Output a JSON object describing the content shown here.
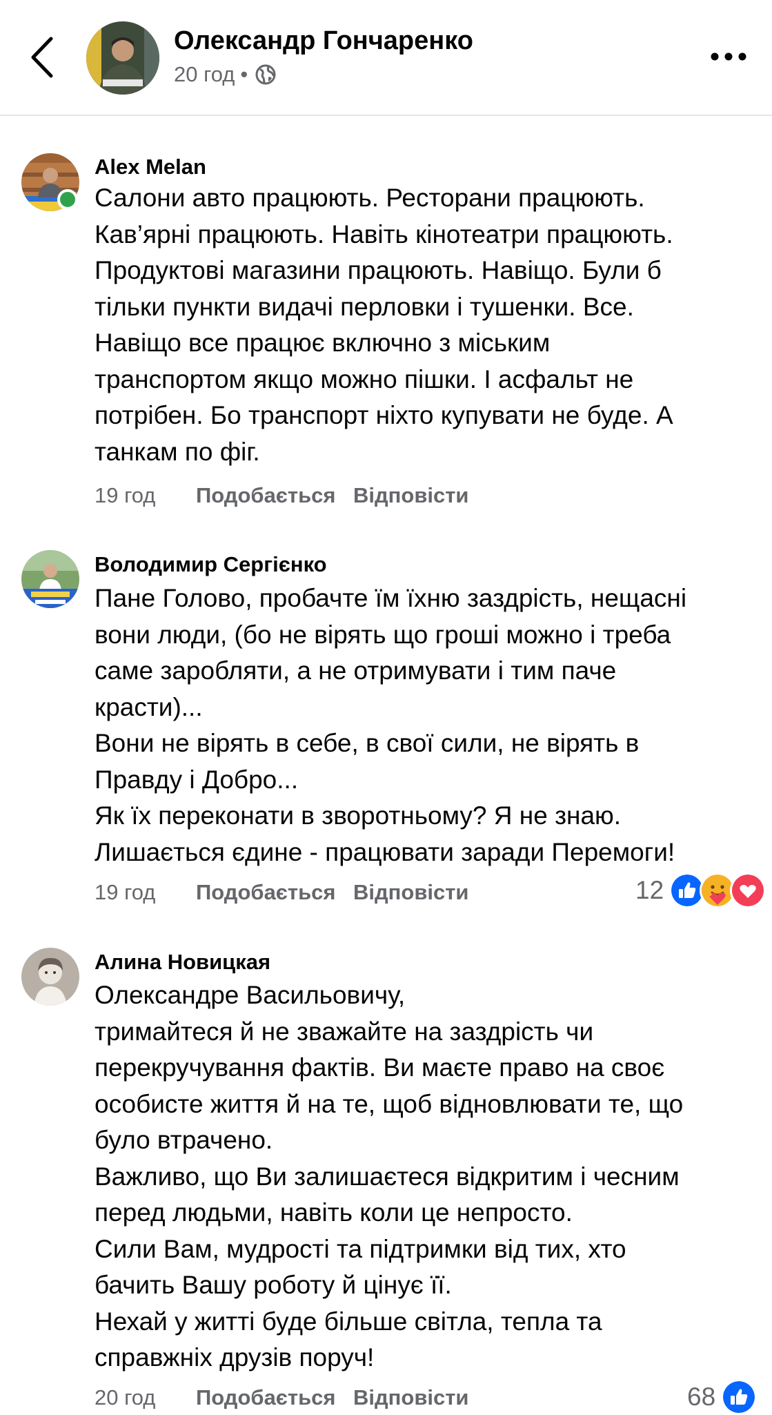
{
  "header": {
    "author_name": "Олександр Гончаренко",
    "time": "20 год",
    "separator": "•"
  },
  "comments": [
    {
      "author": "Alex Melan",
      "lines": [
        "Салони авто працюють. Ресторани працюють.",
        "Кав’ярні працюють. Навіть кінотеатри працюють.",
        "Продуктові магазини працюють. Навіщо. Були б",
        "тільки пункти видачі перловки і тушенки. Все.",
        "Навіщо все працює включно з міським",
        "транспортом якщо можно пішки. І асфальт не",
        "потрібен. Бо транспорт ніхто купувати не буде. А",
        "танкам по фіг."
      ],
      "time": "19 год",
      "like_label": "Подобається",
      "reply_label": "Відповісти"
    },
    {
      "author": "Володимир Сергієнко",
      "lines": [
        "Пане Голово, пробачте їм їхню заздрість, нещасні",
        "вони люди, (бо не вірять що гроші можно і треба",
        "саме заробляти, а не отримувати і тим паче",
        "красти)...",
        "Вони не вірять в себе, в свої сили, не вірять в",
        "Правду і Добро...",
        "Як їх переконати в зворотньому? Я не знаю.",
        "Лишається єдине - працювати заради Перемоги!"
      ],
      "time": "19 год",
      "like_label": "Подобається",
      "reply_label": "Відповісти",
      "reaction_count": "12",
      "reaction_icons": [
        "like-reaction-icon",
        "care-reaction-icon",
        "love-reaction-icon"
      ]
    },
    {
      "author": "Алина Новицкая",
      "lines": [
        "Олександре Васильовичу,",
        "тримайтеся й не зважайте на заздрість чи",
        "перекручування фактів. Ви маєте право на своє",
        "особисте життя й на те, щоб відновлювати те, що",
        "було втрачено.",
        "Важливо, що Ви залишаєтеся відкритим і чесним",
        "перед людьми, навіть коли це непросто.",
        "Сили Вам, мудрості та підтримки від тих, хто",
        "бачить Вашу роботу й цінує її.",
        "Нехай у житті буде більше світла, тепла та",
        "справжніх друзів поруч!"
      ],
      "time": "20 год",
      "like_label": "Подобається",
      "reply_label": "Відповісти",
      "reaction_count": "68",
      "reaction_icons": [
        "like-reaction-icon"
      ]
    }
  ],
  "colors": {
    "text_primary": "#050505",
    "text_secondary": "#65676b",
    "like_blue": "#0866ff",
    "love_red": "#f33e58",
    "online_green": "#31a24c",
    "divider": "#e4e6eb"
  }
}
